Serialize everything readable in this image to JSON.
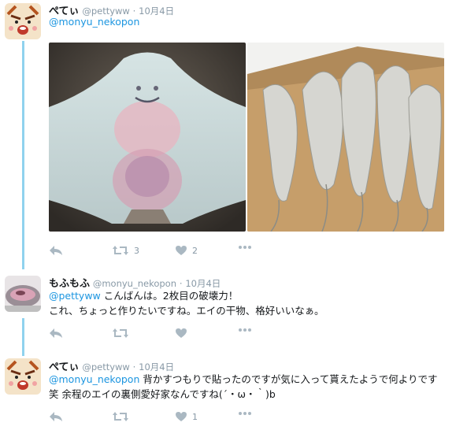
{
  "tweets": [
    {
      "name": "ぺてぃ",
      "handle": "@pettyww",
      "sep": "·",
      "date": "10月4日",
      "mention": "@monyu_nekopon",
      "text": "",
      "reply_count": "",
      "retweet_count": "3",
      "like_count": "2"
    },
    {
      "name": "もふもふ",
      "handle": "@monyu_nekopon",
      "sep": "·",
      "date": "10月4日",
      "mention": "@pettyww",
      "text": " こんばんは。2枚目の破壊力！",
      "text2": "これ、ちょっと作りたいですね。エイの干物、格好いいなぁ。",
      "reply_count": "",
      "retweet_count": "",
      "like_count": ""
    },
    {
      "name": "ぺてぃ",
      "handle": "@pettyww",
      "sep": "·",
      "date": "10月4日",
      "mention": "@monyu_nekopon",
      "text": " 背かすつもりで貼ったのですが気に入って貰えたようで何よりです笑 余程のエイの裏側愛好家なんですね(´・ω・｀)b",
      "reply_count": "",
      "retweet_count": "",
      "like_count": "1"
    }
  ],
  "colors": {
    "accent": "#1b95e0",
    "thread": "#8fd2ee",
    "icon": "#aab8c2"
  }
}
